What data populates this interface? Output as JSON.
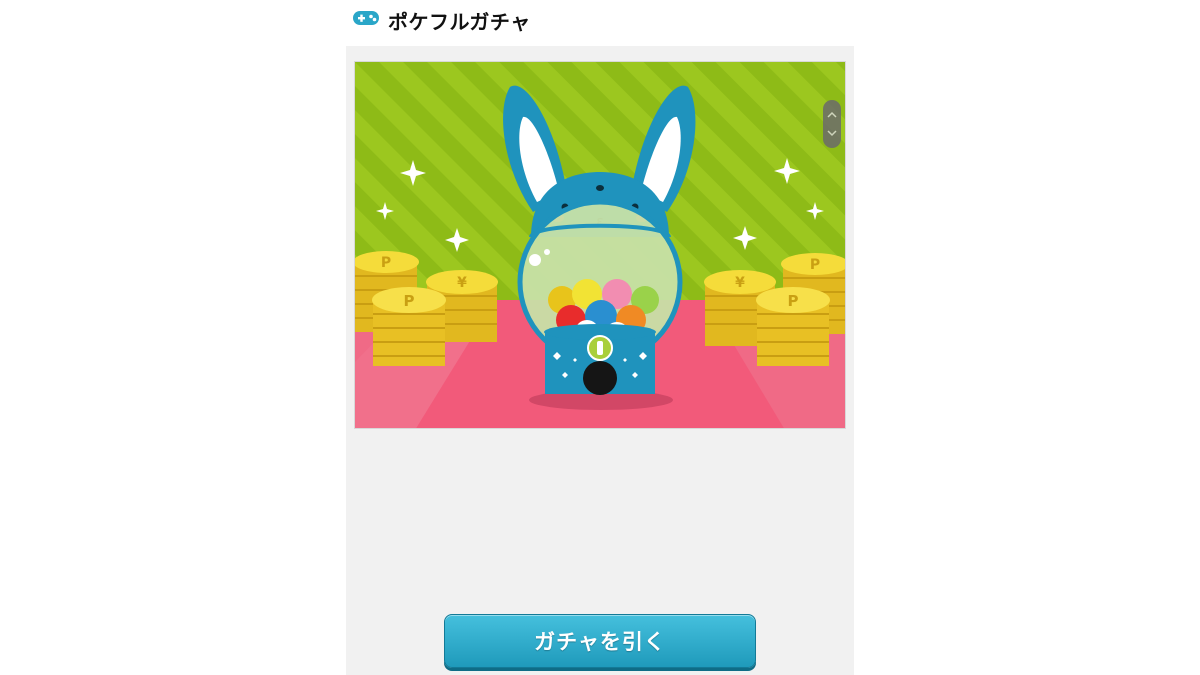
{
  "header": {
    "title": "ポケフルガチャ",
    "icon": "gamepad-icon"
  },
  "stage": {
    "image": "rabbit-gacha-machine-with-coin-stacks",
    "coin_letters": [
      "P",
      "¥"
    ]
  },
  "button": {
    "label": "ガチャを引く"
  },
  "colors": {
    "accent": "#2aa6c8",
    "background_green": "#94c21b",
    "floor_pink": "#f0607e",
    "rabbit_blue": "#1f93bd",
    "coin_gold": "#f2d22e"
  }
}
